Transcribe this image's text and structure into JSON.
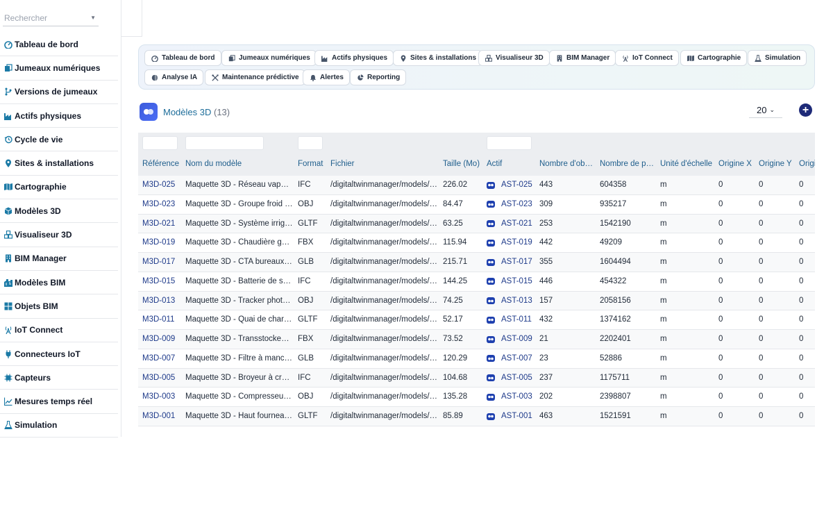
{
  "search": {
    "placeholder": "Rechercher"
  },
  "sidebar": {
    "items": [
      {
        "label": "Tableau de bord",
        "icon": "dashboard-icon"
      },
      {
        "label": "Jumeaux numériques",
        "icon": "copy-icon"
      },
      {
        "label": "Versions de jumeaux",
        "icon": "branch-icon"
      },
      {
        "label": "Actifs physiques",
        "icon": "industry-icon"
      },
      {
        "label": "Cycle de vie",
        "icon": "history-icon"
      },
      {
        "label": "Sites & installations",
        "icon": "location-pin-icon"
      },
      {
        "label": "Cartographie",
        "icon": "map-icon"
      },
      {
        "label": "Modèles 3D",
        "icon": "cube-icon"
      },
      {
        "label": "Visualiseur 3D",
        "icon": "cubes-icon"
      },
      {
        "label": "BIM Manager",
        "icon": "building-icon"
      },
      {
        "label": "Modèles BIM",
        "icon": "city-icon"
      },
      {
        "label": "Objets BIM",
        "icon": "grid-icon"
      },
      {
        "label": "IoT Connect",
        "icon": "broadcast-icon"
      },
      {
        "label": "Connecteurs IoT",
        "icon": "plug-icon"
      },
      {
        "label": "Capteurs",
        "icon": "chip-icon"
      },
      {
        "label": "Mesures temps réel",
        "icon": "line-chart-icon"
      },
      {
        "label": "Simulation",
        "icon": "flask-icon"
      }
    ]
  },
  "toolbar": {
    "chips": [
      {
        "label": "Tableau de bord",
        "icon": "dashboard-icon"
      },
      {
        "label": "Jumeaux numériques",
        "icon": "copy-icon"
      },
      {
        "label": "Actifs physiques",
        "icon": "industry-icon"
      },
      {
        "label": "Sites & installations",
        "icon": "location-pin-icon"
      },
      {
        "label": "Visualiseur 3D",
        "icon": "cubes-icon"
      },
      {
        "label": "BIM Manager",
        "icon": "building-icon"
      },
      {
        "label": "IoT Connect",
        "icon": "broadcast-icon"
      },
      {
        "label": "Cartographie",
        "icon": "map-icon"
      },
      {
        "label": "Simulation",
        "icon": "flask-icon"
      },
      {
        "label": "Analyse IA",
        "icon": "brain-icon"
      },
      {
        "label": "Maintenance prédictive",
        "icon": "tools-icon"
      },
      {
        "label": "Alertes",
        "icon": "bell-icon"
      },
      {
        "label": "Reporting",
        "icon": "pie-chart-icon"
      }
    ]
  },
  "header": {
    "title": "Modèles 3D",
    "count": "(13)",
    "page_size": "20",
    "add_label": "+"
  },
  "table": {
    "columns": [
      "Référence",
      "Nom du modèle",
      "Format",
      "Fichier",
      "Taille (Mo)",
      "Actif",
      "Nombre d'ob…",
      "Nombre de p…",
      "Unité d'échelle",
      "Origine X",
      "Origine Y",
      "Origi"
    ],
    "rows": [
      [
        "M3D-025",
        "Maquette 3D - Réseau vape…",
        "IFC",
        "/digitaltwinmanager/models/…",
        "226.02",
        "AST-025",
        "443",
        "604358",
        "m",
        "0",
        "0",
        "0"
      ],
      [
        "M3D-023",
        "Maquette 3D - Groupe froid …",
        "OBJ",
        "/digitaltwinmanager/models/…",
        "84.47",
        "AST-023",
        "309",
        "935217",
        "m",
        "0",
        "0",
        "0"
      ],
      [
        "M3D-021",
        "Maquette 3D - Système irrig…",
        "GLTF",
        "/digitaltwinmanager/models/…",
        "63.25",
        "AST-021",
        "253",
        "1542190",
        "m",
        "0",
        "0",
        "0"
      ],
      [
        "M3D-019",
        "Maquette 3D - Chaudière g…",
        "FBX",
        "/digitaltwinmanager/models/…",
        "115.94",
        "AST-019",
        "442",
        "49209",
        "m",
        "0",
        "0",
        "0"
      ],
      [
        "M3D-017",
        "Maquette 3D - CTA bureaux…",
        "GLB",
        "/digitaltwinmanager/models/…",
        "215.71",
        "AST-017",
        "355",
        "1604494",
        "m",
        "0",
        "0",
        "0"
      ],
      [
        "M3D-015",
        "Maquette 3D - Batterie de st…",
        "IFC",
        "/digitaltwinmanager/models/…",
        "144.25",
        "AST-015",
        "446",
        "454322",
        "m",
        "0",
        "0",
        "0"
      ],
      [
        "M3D-013",
        "Maquette 3D - Tracker phot…",
        "OBJ",
        "/digitaltwinmanager/models/…",
        "74.25",
        "AST-013",
        "157",
        "2058156",
        "m",
        "0",
        "0",
        "0"
      ],
      [
        "M3D-011",
        "Maquette 3D - Quai de char…",
        "GLTF",
        "/digitaltwinmanager/models/…",
        "52.17",
        "AST-011",
        "432",
        "1374162",
        "m",
        "0",
        "0",
        "0"
      ],
      [
        "M3D-009",
        "Maquette 3D - Transstockeu…",
        "FBX",
        "/digitaltwinmanager/models/…",
        "73.52",
        "AST-009",
        "21",
        "2202401",
        "m",
        "0",
        "0",
        "0"
      ],
      [
        "M3D-007",
        "Maquette 3D - Filtre à manc…",
        "GLB",
        "/digitaltwinmanager/models/…",
        "120.29",
        "AST-007",
        "23",
        "52886",
        "m",
        "0",
        "0",
        "0"
      ],
      [
        "M3D-005",
        "Maquette 3D - Broyeur à cr…",
        "IFC",
        "/digitaltwinmanager/models/…",
        "104.68",
        "AST-005",
        "237",
        "1175711",
        "m",
        "0",
        "0",
        "0"
      ],
      [
        "M3D-003",
        "Maquette 3D - Compresseu…",
        "OBJ",
        "/digitaltwinmanager/models/…",
        "135.28",
        "AST-003",
        "202",
        "2398807",
        "m",
        "0",
        "0",
        "0"
      ],
      [
        "M3D-001",
        "Maquette 3D - Haut fournea…",
        "GLTF",
        "/digitaltwinmanager/models/…",
        "85.89",
        "AST-001",
        "463",
        "1521591",
        "m",
        "0",
        "0",
        "0"
      ]
    ]
  },
  "colors": {
    "accent": "#1e2a78",
    "link": "#1e3a8a",
    "title": "#1d6d9a",
    "icon_teal": "#1b7aa6"
  }
}
